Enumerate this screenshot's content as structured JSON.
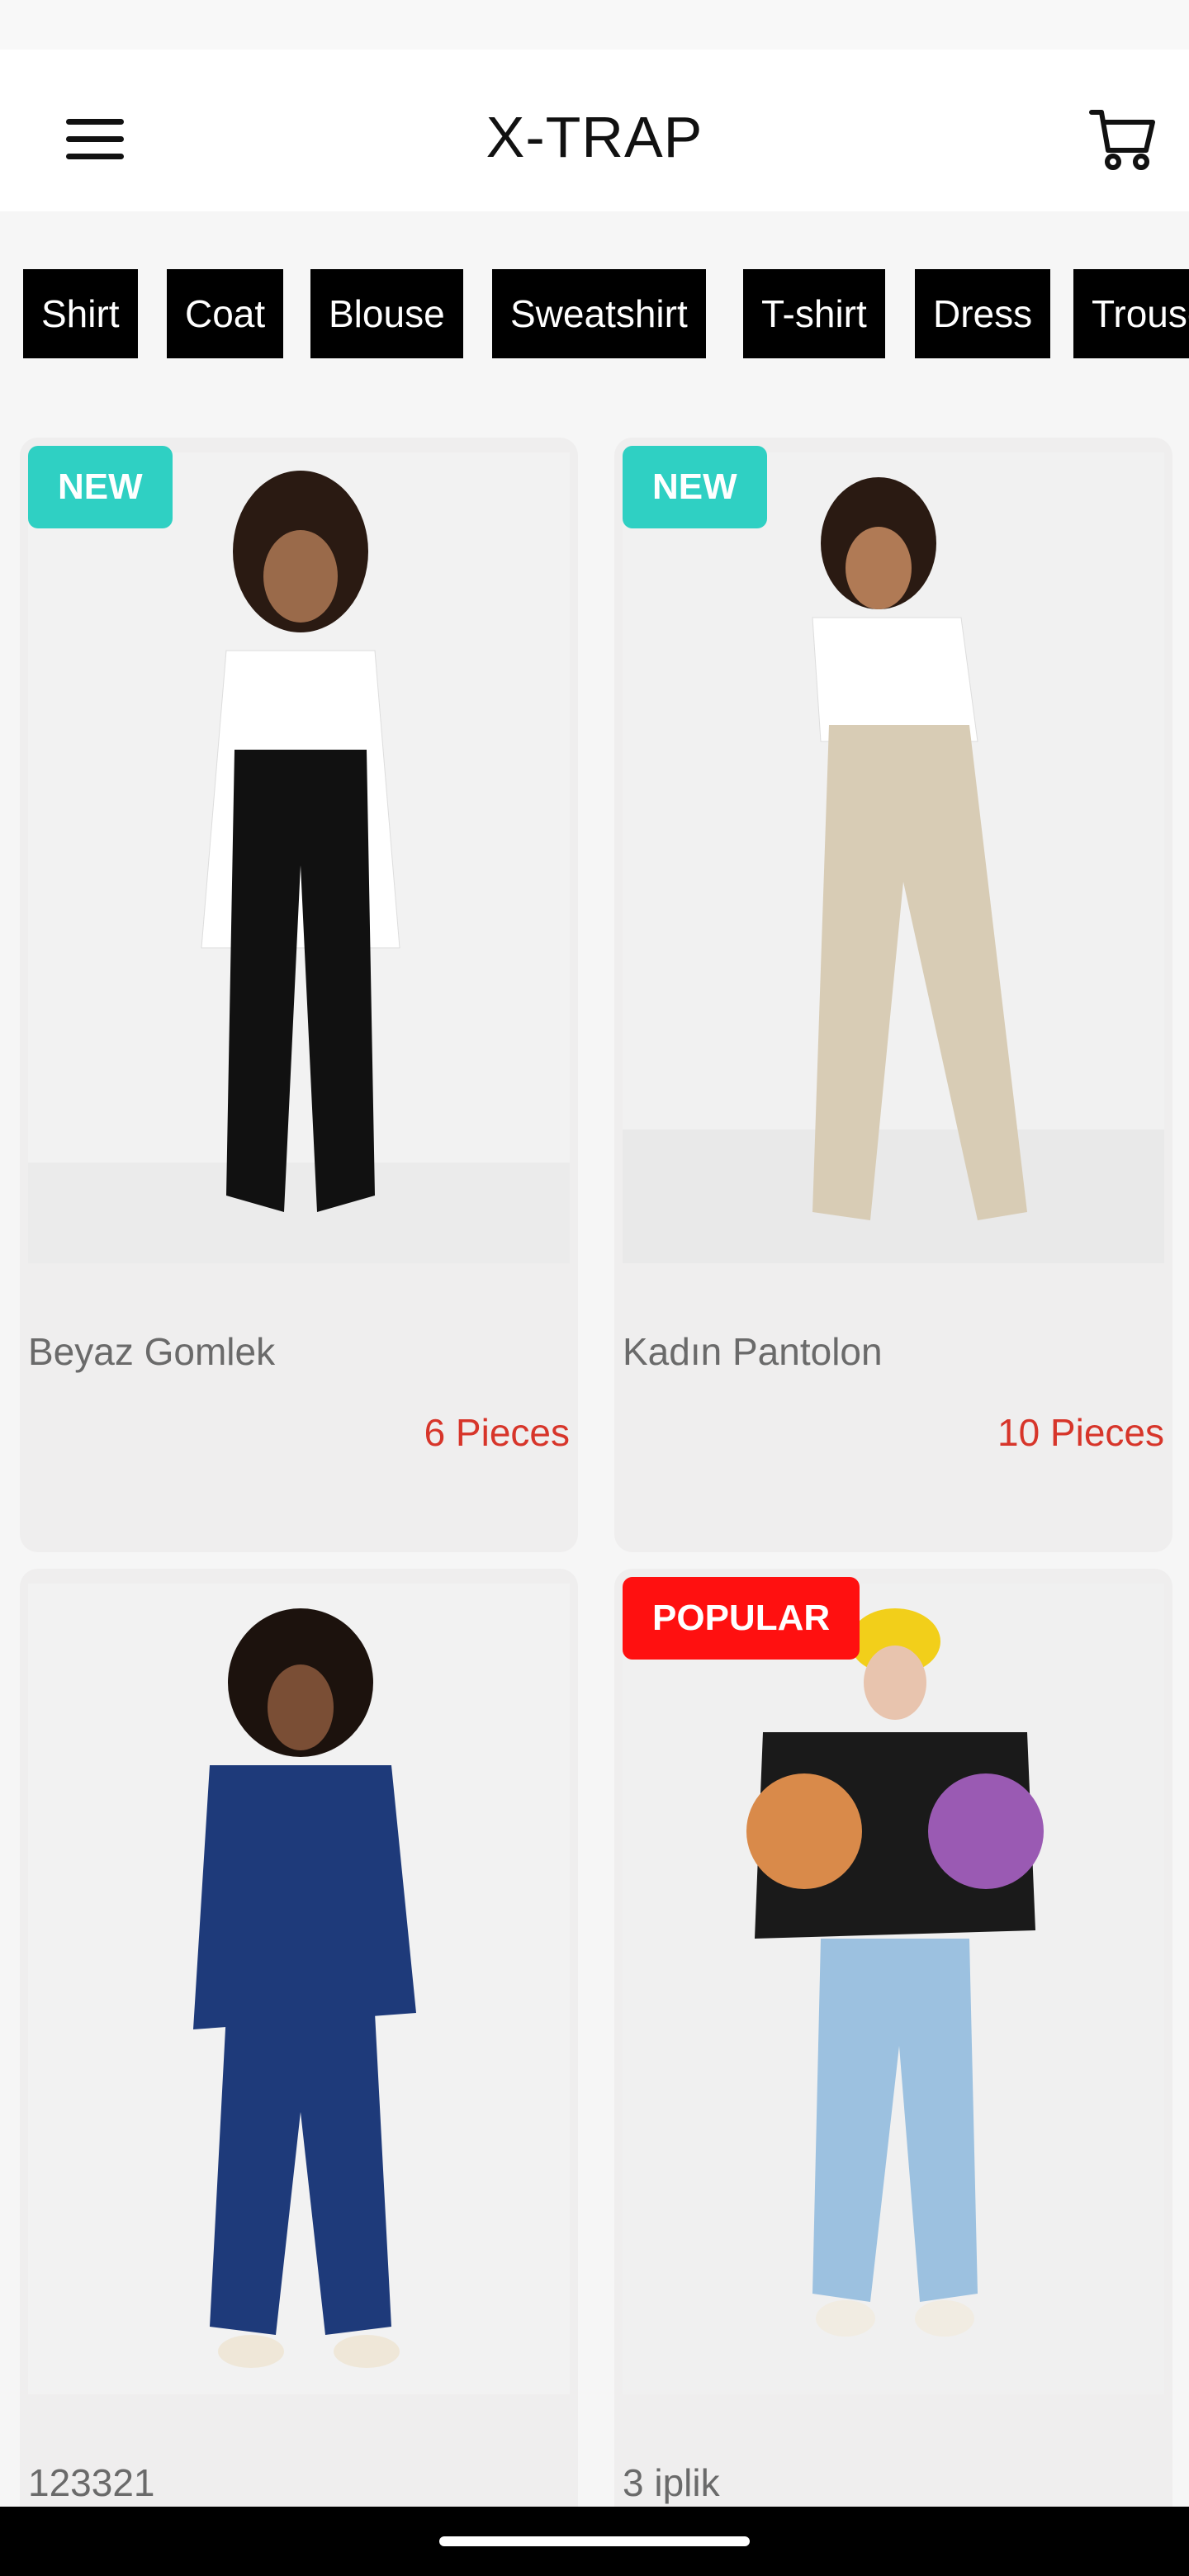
{
  "header": {
    "title": "X-TRAP",
    "menu_icon": "hamburger-menu-icon",
    "cart_icon": "shopping-cart-icon"
  },
  "categories": [
    "Shirt",
    "Coat",
    "Blouse",
    "Sweatshirt",
    "T-shirt",
    "Dress",
    "Trousers"
  ],
  "products": [
    {
      "name": "Beyaz Gomlek",
      "pieces": "6 Pieces",
      "badge": "NEW",
      "badge_color": "#2fd0c3"
    },
    {
      "name": "Kadın Pantolon",
      "pieces": "10 Pieces",
      "badge": "NEW",
      "badge_color": "#2fd0c3"
    },
    {
      "name": "123321",
      "pieces": "",
      "badge": "",
      "badge_color": ""
    },
    {
      "name": "3 iplik",
      "pieces": "",
      "badge": "POPULAR",
      "badge_color": "#ff1010"
    }
  ],
  "colors": {
    "accent_new": "#2fd0c3",
    "accent_popular": "#ff1010",
    "price_red": "#d7352a",
    "chip_bg": "#000000"
  }
}
